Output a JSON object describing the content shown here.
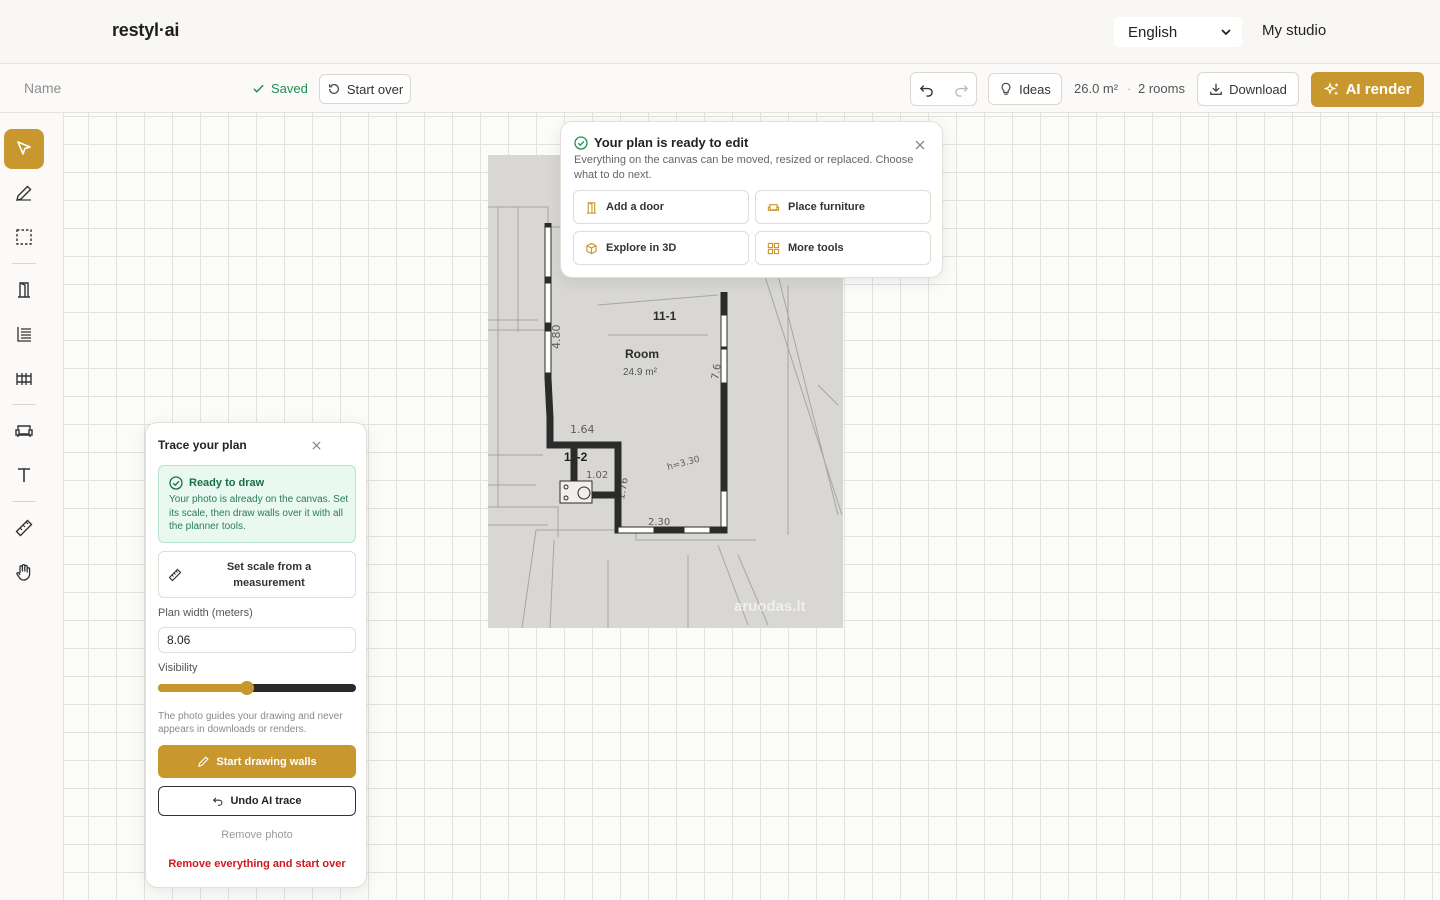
{
  "app": {
    "logo": "restyl·ai"
  },
  "header": {
    "language": "English",
    "my_studio": "My studio"
  },
  "toolbar": {
    "name_placeholder": "Name",
    "saved": "Saved",
    "start_over": "Start over",
    "ideas": "Ideas",
    "area": "26.0 m²",
    "separator": "·",
    "rooms": "2 rooms",
    "download": "Download",
    "ai_render": "AI render"
  },
  "sidebar": {
    "tools": [
      "select-tool",
      "pencil-tool",
      "selection-rect-tool",
      "door-tool",
      "stairs-tool",
      "fence-tool",
      "furniture-tool",
      "text-tool",
      "ruler-tool",
      "pan-tool"
    ],
    "active": "select-tool"
  },
  "plan": {
    "labels": [
      "11-1",
      "Room",
      "24.9 m²",
      "4.80",
      "1.64",
      "11-2",
      "1.02",
      "1.76",
      "h=3.30",
      "2.30",
      "7.6",
      "aruodas.lt"
    ]
  },
  "popover": {
    "title": "Your plan is ready to edit",
    "description": "Everything on the canvas can be moved, resized or replaced. Choose what to do next.",
    "buttons": {
      "add_door": "Add a door",
      "place_furniture": "Place furniture",
      "explore_3d": "Explore in 3D",
      "more_tools": "More tools"
    }
  },
  "trace": {
    "title": "Trace your plan",
    "ready_title": "Ready to draw",
    "ready_desc": "Your photo is already on the canvas. Set its scale, then draw walls over it with all the planner tools.",
    "set_scale": "Set scale from a measurement",
    "plan_width_label": "Plan width (meters)",
    "plan_width_value": "8.06",
    "visibility_label": "Visibility",
    "visibility_value": 0.45,
    "hint": "The photo guides your drawing and never appears in downloads or renders.",
    "start_drawing": "Start drawing walls",
    "undo_ai_trace": "Undo AI trace",
    "remove_photo": "Remove photo",
    "remove_everything": "Remove everything and start over"
  },
  "colors": {
    "accent": "#c8982f",
    "success": "#1f8f57",
    "danger": "#d0191e"
  }
}
